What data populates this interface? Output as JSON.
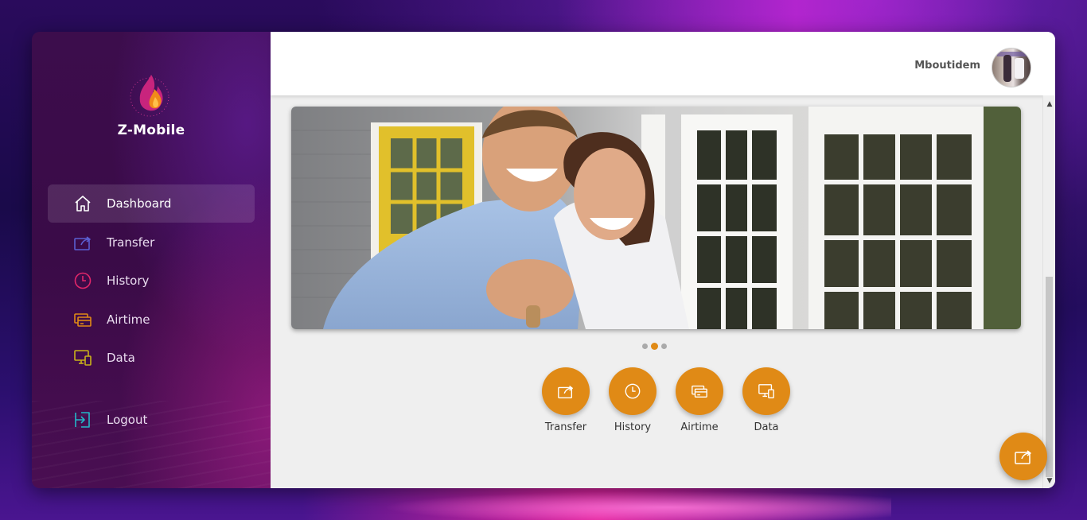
{
  "app": {
    "brand_name": "Z-Mobile"
  },
  "sidebar": {
    "items": [
      {
        "label": "Dashboard",
        "icon": "home-icon",
        "active": true,
        "icon_color": "#ffffff"
      },
      {
        "label": "Transfer",
        "icon": "transfer-icon",
        "active": false,
        "icon_color": "#5b5fd1"
      },
      {
        "label": "History",
        "icon": "clock-icon",
        "active": false,
        "icon_color": "#e2266a"
      },
      {
        "label": "Airtime",
        "icon": "card-icon",
        "active": false,
        "icon_color": "#e08a16"
      },
      {
        "label": "Data",
        "icon": "devices-icon",
        "active": false,
        "icon_color": "#c9b21a"
      }
    ],
    "logout": {
      "label": "Logout",
      "icon": "logout-icon",
      "icon_color": "#23b7c9"
    }
  },
  "header": {
    "username": "Mboutidem",
    "avatar": "user-avatar"
  },
  "carousel": {
    "slides": 3,
    "active_slide": 2
  },
  "quick_actions": [
    {
      "label": "Transfer",
      "icon": "transfer-icon"
    },
    {
      "label": "History",
      "icon": "clock-icon"
    },
    {
      "label": "Airtime",
      "icon": "card-icon"
    },
    {
      "label": "Data",
      "icon": "devices-icon"
    }
  ],
  "fab": {
    "icon": "transfer-icon"
  },
  "colors": {
    "accent": "#e08a16",
    "sidebar_bg": "#3c0d4c"
  }
}
